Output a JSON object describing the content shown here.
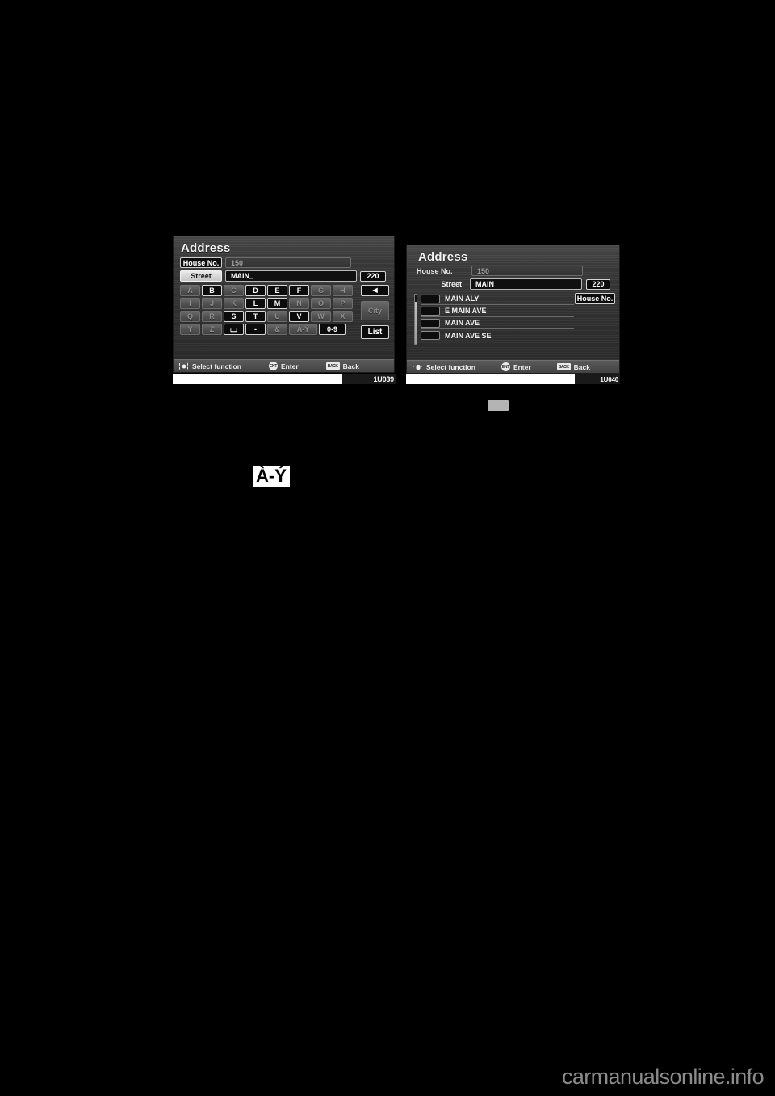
{
  "page": {
    "background": "#000000",
    "watermark": "carmanualsonline.info"
  },
  "screens": [
    {
      "id": "address-keyboard",
      "title": "Address",
      "figure_id": "1U039",
      "fields": [
        {
          "label": "House No.",
          "label_state": "button",
          "value": "150",
          "state": "inactive"
        },
        {
          "label": "Street",
          "label_state": "selected",
          "value": "MAIN_",
          "state": "active",
          "count": "220"
        }
      ],
      "keyboard": {
        "rows": [
          [
            {
              "key": "A",
              "state": "dim"
            },
            {
              "key": "B",
              "state": "on"
            },
            {
              "key": "C",
              "state": "dim"
            },
            {
              "key": "D",
              "state": "on"
            },
            {
              "key": "E",
              "state": "on"
            },
            {
              "key": "F",
              "state": "on"
            },
            {
              "key": "G",
              "state": "dim"
            },
            {
              "key": "H",
              "state": "dim"
            }
          ],
          [
            {
              "key": "I",
              "state": "dim"
            },
            {
              "key": "J",
              "state": "dim"
            },
            {
              "key": "K",
              "state": "dim"
            },
            {
              "key": "L",
              "state": "on"
            },
            {
              "key": "M",
              "state": "on"
            },
            {
              "key": "N",
              "state": "dim"
            },
            {
              "key": "O",
              "state": "dim"
            },
            {
              "key": "P",
              "state": "dim"
            }
          ],
          [
            {
              "key": "Q",
              "state": "dim"
            },
            {
              "key": "R",
              "state": "dim"
            },
            {
              "key": "S",
              "state": "on"
            },
            {
              "key": "T",
              "state": "on"
            },
            {
              "key": "U",
              "state": "dim"
            },
            {
              "key": "V",
              "state": "on"
            },
            {
              "key": "W",
              "state": "dim"
            },
            {
              "key": "X",
              "state": "dim"
            }
          ],
          [
            {
              "key": "Y",
              "state": "dim"
            },
            {
              "key": "Z",
              "state": "dim"
            },
            {
              "key": "⌴",
              "state": "on",
              "name": "space-key"
            },
            {
              "key": "-",
              "state": "on",
              "name": "hyphen-key"
            },
            {
              "key": "&",
              "state": "dim"
            },
            {
              "key": "À-Ý",
              "state": "dim",
              "name": "accented-chars-key"
            },
            {
              "key": "0-9",
              "state": "on",
              "name": "numbers-key"
            }
          ]
        ]
      },
      "side_buttons": [
        {
          "label": "◄",
          "name": "backspace-button",
          "state": "on"
        },
        {
          "label": "City",
          "name": "city-button",
          "state": "dim"
        },
        {
          "label": "List",
          "name": "list-button",
          "state": "on"
        }
      ],
      "footer": {
        "select": "Select function",
        "enter_icon": "ENT",
        "enter": "Enter",
        "back_icon": "BACK",
        "back": "Back"
      }
    },
    {
      "id": "address-street-list",
      "title": "Address",
      "figure_id": "1U040",
      "fields": [
        {
          "label": "House No.",
          "label_state": "plain",
          "value": "150",
          "state": "inactive"
        },
        {
          "label": "Street",
          "label_state": "plain",
          "value": "MAIN",
          "state": "active",
          "count": "220"
        }
      ],
      "list": [
        {
          "text": "MAIN ALY"
        },
        {
          "text": "E MAIN AVE"
        },
        {
          "text": "MAIN AVE"
        },
        {
          "text": "MAIN AVE SE"
        }
      ],
      "side_buttons": [
        {
          "label": "House No.",
          "name": "house-no-button",
          "state": "on"
        }
      ],
      "footer": {
        "select": "Select function",
        "enter_icon": "ENT",
        "enter": "Enter",
        "back_icon": "BACK",
        "back": "Back"
      }
    }
  ],
  "inline_glyph": {
    "label": "À-Ý",
    "name": "accented-chars-glyph"
  }
}
